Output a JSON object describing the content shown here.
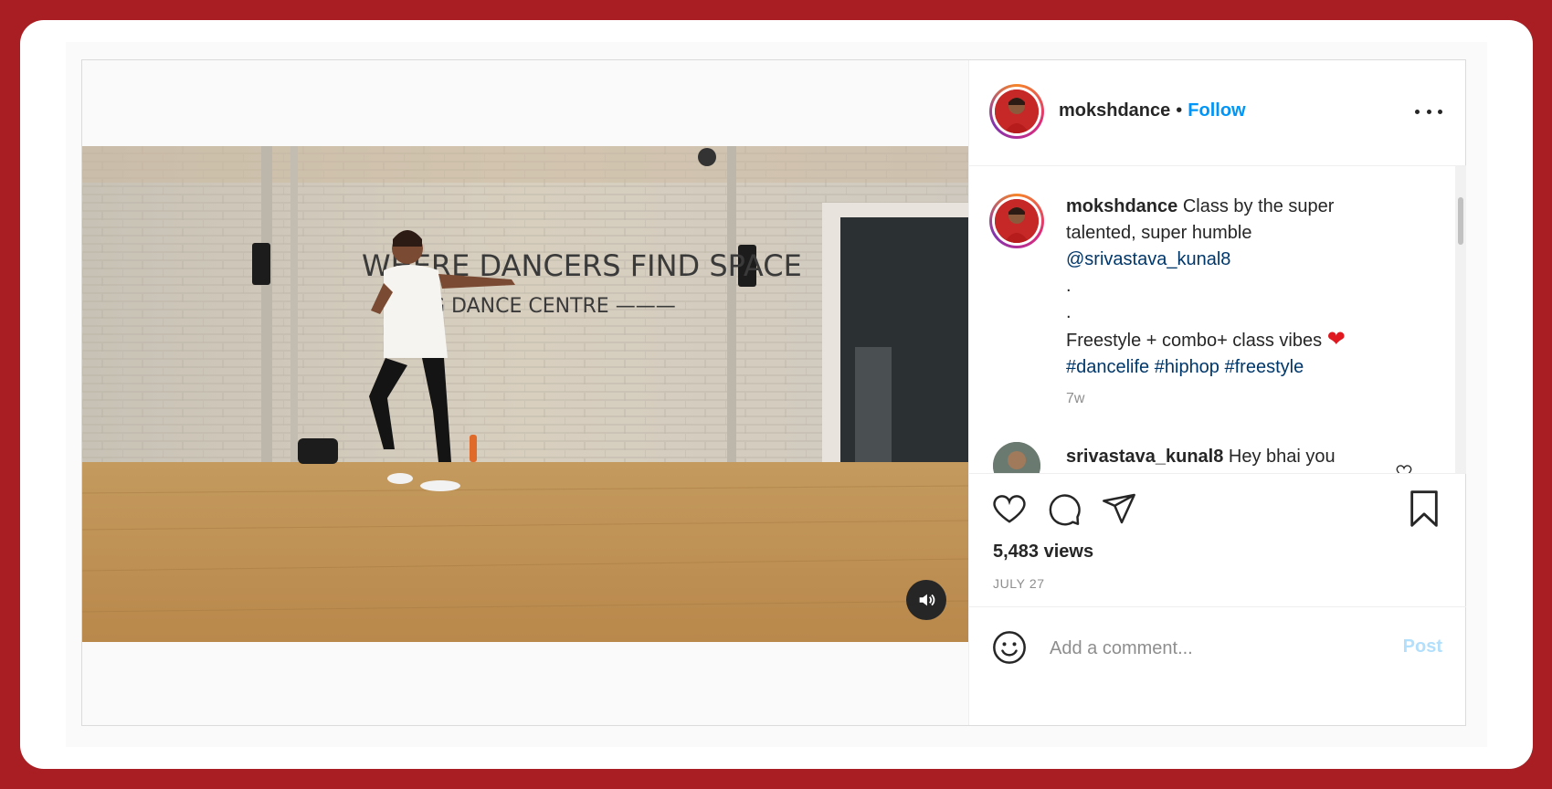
{
  "post": {
    "username": "mokshdance",
    "separator": "•",
    "follow_label": "Follow",
    "video_wall_text_1": "WHERE DANCERS FIND SPACE",
    "video_wall_text_2": "G DANCE CENTRE ———",
    "caption": {
      "username": "mokshdance",
      "line1": "Class by the super talented, super humble",
      "mention": "@srivastava_kunal8",
      "dot1": ".",
      "dot2": ".",
      "line_vibes": "Freestyle + combo+ class vibes",
      "heart_emoji": "❤",
      "hashtag1": "#dancelife",
      "hashtag2": "#hiphop",
      "hashtag3": "#freestyle",
      "time_ago": "7w"
    },
    "comment": {
      "username": "srivastava_kunal8",
      "text": "Hey bhai you"
    },
    "views": "5,483 views",
    "date": "JULY 27",
    "comment_placeholder": "Add a comment...",
    "post_label": "Post"
  },
  "colors": {
    "border_frame": "#a81e22",
    "accent_blue": "#0095f6",
    "link_blue": "#00376b",
    "post_disabled": "#b2dffc",
    "heart_red": "#e0181f"
  },
  "icons": [
    "more-icon",
    "heart-icon",
    "comment-icon",
    "share-icon",
    "bookmark-icon",
    "emoji-icon",
    "volume-icon",
    "comment-heart-icon"
  ]
}
